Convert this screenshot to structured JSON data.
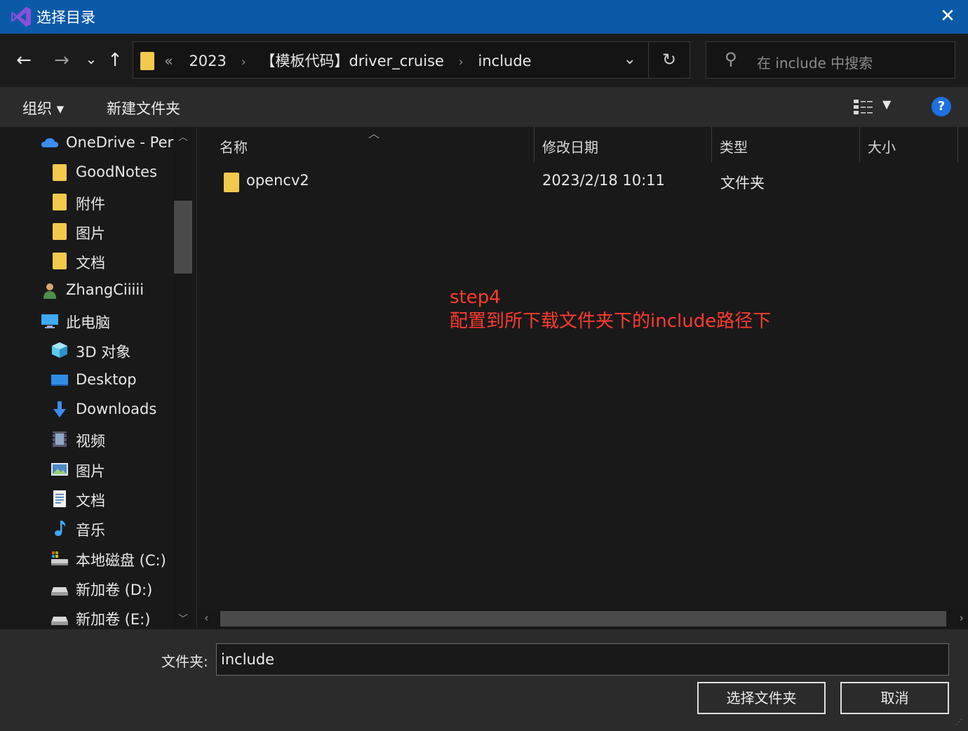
{
  "window": {
    "title": "选择目录",
    "close_glyph": "✕",
    "accent": "#0b5aa8"
  },
  "nav": {
    "back_glyph": "←",
    "forward_glyph": "→",
    "recent_glyph": "⌄",
    "up_glyph": "↑",
    "breadcrumb_overflow": "«",
    "breadcrumbs": [
      "2023",
      "【模板代码】driver_cruise",
      "include"
    ],
    "refresh_glyph": "↻",
    "search_placeholder": "在 include 中搜索"
  },
  "toolbar": {
    "organize": "组织 ▾",
    "new_folder": "新建文件夹",
    "help": "?"
  },
  "sidebar": {
    "items": [
      {
        "label": "OneDrive - Per",
        "icon": "cloud-icon"
      },
      {
        "label": "GoodNotes",
        "icon": "folder-icon"
      },
      {
        "label": "附件",
        "icon": "folder-icon"
      },
      {
        "label": "图片",
        "icon": "folder-icon"
      },
      {
        "label": "文档",
        "icon": "folder-icon"
      },
      {
        "label": "ZhangCiiiii",
        "icon": "user-icon"
      },
      {
        "label": "此电脑",
        "icon": "computer-icon"
      },
      {
        "label": "3D 对象",
        "icon": "cube-icon"
      },
      {
        "label": "Desktop",
        "icon": "desktop-icon"
      },
      {
        "label": "Downloads",
        "icon": "download-icon"
      },
      {
        "label": "视频",
        "icon": "video-icon"
      },
      {
        "label": "图片",
        "icon": "pictures-icon"
      },
      {
        "label": "文档",
        "icon": "document-icon"
      },
      {
        "label": "音乐",
        "icon": "music-icon"
      },
      {
        "label": "本地磁盘 (C:)",
        "icon": "system-drive-icon"
      },
      {
        "label": "新加卷 (D:)",
        "icon": "drive-icon"
      },
      {
        "label": "新加卷 (E:)",
        "icon": "drive-icon"
      }
    ]
  },
  "columns": {
    "name": "名称",
    "modified": "修改日期",
    "type": "类型",
    "size": "大小"
  },
  "files": [
    {
      "name": "opencv2",
      "modified": "2023/2/18 10:11",
      "type": "文件夹",
      "size": ""
    }
  ],
  "annotation": {
    "line1": "step4",
    "line2": "配置到所下载文件夹下的include路径下",
    "color": "#ff3b30"
  },
  "footer": {
    "folder_label": "文件夹:",
    "folder_value": "include",
    "select_button": "选择文件夹",
    "cancel_button": "取消"
  }
}
